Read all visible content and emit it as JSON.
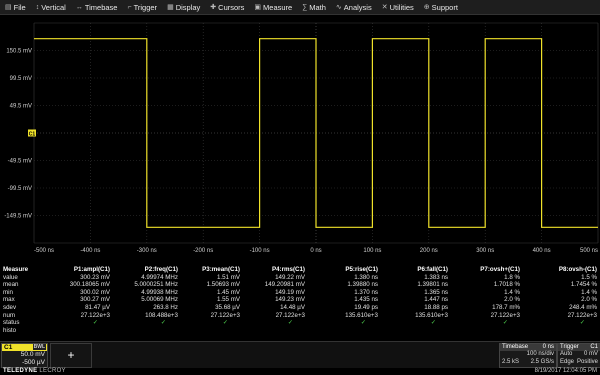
{
  "menu": {
    "items": [
      {
        "label": "File",
        "icon": "file-icon",
        "glyph": "▤"
      },
      {
        "label": "Vertical",
        "icon": "vertical-icon",
        "glyph": "↕"
      },
      {
        "label": "Timebase",
        "icon": "timebase-icon",
        "glyph": "↔"
      },
      {
        "label": "Trigger",
        "icon": "trigger-icon",
        "glyph": "⌐"
      },
      {
        "label": "Display",
        "icon": "display-icon",
        "glyph": "▦"
      },
      {
        "label": "Cursors",
        "icon": "cursors-icon",
        "glyph": "✚"
      },
      {
        "label": "Measure",
        "icon": "measure-icon",
        "glyph": "▣"
      },
      {
        "label": "Math",
        "icon": "math-icon",
        "glyph": "∑"
      },
      {
        "label": "Analysis",
        "icon": "analysis-icon",
        "glyph": "∿"
      },
      {
        "label": "Utilities",
        "icon": "utilities-icon",
        "glyph": "✕"
      },
      {
        "label": "Support",
        "icon": "support-icon",
        "glyph": "⊕"
      }
    ]
  },
  "scope": {
    "y_labels": [
      "150.5 mV",
      "99.5 mV",
      "49.5 mV",
      "",
      "-49.5 mV",
      "-99.5 mV",
      "-149.5 mV"
    ],
    "x_labels": [
      "-500 ns",
      "-400 ns",
      "-300 ns",
      "-200 ns",
      "-100 ns",
      "0 ns",
      "100 ns",
      "200 ns",
      "300 ns",
      "400 ns",
      "500 ns"
    ],
    "channel_marker": "C1",
    "trace_color": "#f0e22a",
    "trace": {
      "high_mv": 150,
      "low_mv": -150,
      "period_ns": 200,
      "x_range_ns": [
        -500,
        500
      ],
      "y_range_mv": [
        -175,
        175
      ],
      "rising_edges_ns": [
        -100,
        100,
        300
      ],
      "falling_edges_ns": [
        -300,
        0,
        200,
        400
      ]
    }
  },
  "measure": {
    "title": "Measure",
    "params": [
      "P1:ampl(C1)",
      "P2:freq(C1)",
      "P3:mean(C1)",
      "P4:rms(C1)",
      "P5:rise(C1)",
      "P6:fall(C1)",
      "P7:ovsh+(C1)",
      "P8:ovsh-(C1)"
    ],
    "rows": [
      {
        "label": "value",
        "cells": [
          "300.23 mV",
          "4.99974 MHz",
          "1.51 mV",
          "149.22 mV",
          "1.380 ns",
          "1.383 ns",
          "1.8 %",
          "1.5 %"
        ]
      },
      {
        "label": "mean",
        "cells": [
          "300.18065 mV",
          "5.0000251 MHz",
          "1.50693 mV",
          "149.20981 mV",
          "1.39880 ns",
          "1.39801 ns",
          "1.7018 %",
          "1.7454 %"
        ]
      },
      {
        "label": "min",
        "cells": [
          "300.02 mV",
          "4.99938 MHz",
          "1.45 mV",
          "149.19 mV",
          "1.370 ns",
          "1.365 ns",
          "1.4 %",
          "1.4 %"
        ]
      },
      {
        "label": "max",
        "cells": [
          "300.27 mV",
          "5.00069 MHz",
          "1.55 mV",
          "149.23 mV",
          "1.435 ns",
          "1.447 ns",
          "2.0 %",
          "2.0 %"
        ]
      },
      {
        "label": "sdev",
        "cells": [
          "81.47 µV",
          "263.8 Hz",
          "35.68 µV",
          "14.48 µV",
          "19.49 ps",
          "18.88 ps",
          "178.7 m%",
          "248.4 m%"
        ]
      },
      {
        "label": "num",
        "cells": [
          "27.122e+3",
          "108.488e+3",
          "27.122e+3",
          "27.122e+3",
          "135.610e+3",
          "135.610e+3",
          "27.122e+3",
          "27.122e+3"
        ]
      }
    ],
    "status_label": "status",
    "status_mark": "✓",
    "histo_label": "histo"
  },
  "channel": {
    "name": "C1",
    "bw_badge": "BWL",
    "vdiv": "50.0 mV",
    "offset": "-500 µV"
  },
  "add_button": "+",
  "timebase": {
    "title": "Timebase",
    "delay": "0 ns",
    "tdiv": "100 ns/div",
    "samples": "2.5 kS",
    "rate": "2.5 GS/s"
  },
  "trigger": {
    "title": "Trigger",
    "channel": "C1",
    "level": "0 mV",
    "mode": "Auto",
    "type": "Edge",
    "slope": "Positive"
  },
  "footer": {
    "brand_bold": "TELEDYNE",
    "brand_light": "LECROY",
    "datetime": "8/19/2017 12:04:05 PM"
  },
  "colors": {
    "trace": "#f0e22a",
    "check": "#4fd24f",
    "grid": "#3a3a3a"
  }
}
